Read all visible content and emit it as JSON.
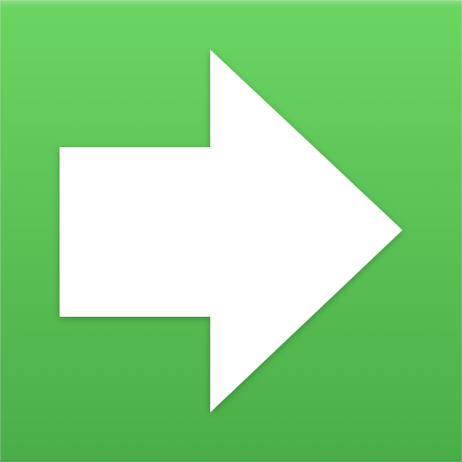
{
  "icon": {
    "name": "arrow-right-icon",
    "background_color_top": "#6bd562",
    "background_color_bottom": "#4aae48",
    "arrow_color": "#ffffff"
  }
}
